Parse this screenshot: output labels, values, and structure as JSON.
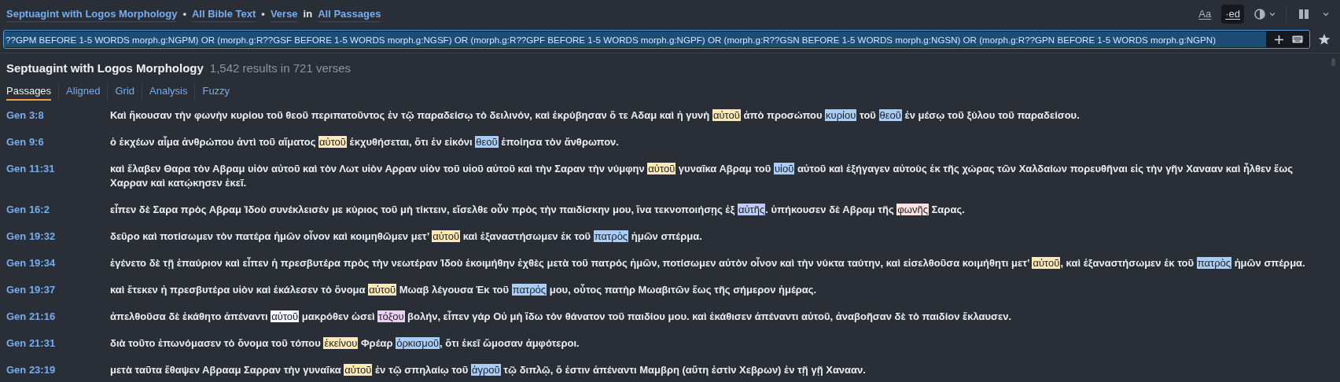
{
  "breadcrumb": [
    {
      "kind": "link",
      "text": "Septuagint with Logos Morphology"
    },
    {
      "kind": "dot",
      "text": "•"
    },
    {
      "kind": "link",
      "text": "All Bible Text"
    },
    {
      "kind": "dot",
      "text": "•"
    },
    {
      "kind": "link",
      "text": "Verse"
    },
    {
      "kind": "plain",
      "text": "in"
    },
    {
      "kind": "link",
      "text": "All Passages"
    }
  ],
  "toolbar": [
    {
      "kind": "text",
      "label": "Aa",
      "selected": false
    },
    {
      "kind": "text",
      "label": "·ed",
      "selected": true
    },
    {
      "kind": "contrast"
    },
    {
      "kind": "columns"
    }
  ],
  "query": {
    "value": "??GPM BEFORE 1-5 WORDS morph.g:NGPM) OR (morph.g:R??GSF BEFORE 1-5 WORDS morph.g:NGSF) OR (morph.g:R??GPF BEFORE 1-5 WORDS morph.g:NGPF) OR (morph.g:R??GSN BEFORE 1-5 WORDS morph.g:NGSN) OR (morph.g:R??GPN BEFORE 1-5 WORDS morph.g:NGPN)"
  },
  "results": {
    "title": "Septuagint with Logos Morphology",
    "summary": "1,542 results in 721 verses"
  },
  "tabs": [
    {
      "label": "Passages",
      "selected": true
    },
    {
      "label": "Aligned",
      "selected": false
    },
    {
      "label": "Grid",
      "selected": false
    },
    {
      "label": "Analysis",
      "selected": false
    },
    {
      "label": "Fuzzy",
      "selected": false
    }
  ],
  "verses": [
    {
      "ref": "Gen 3:8",
      "segments": [
        {
          "text": "Καὶ ἤκουσαν τὴν φωνὴν κυρίου τοῦ θεοῦ περιπατοῦντος ἐν τῷ παραδείσῳ τὸ δειλινόν, καὶ ἐκρύβησαν ὅ τε Αδαμ καὶ ἡ γυνὴ "
        },
        {
          "text": "αὐτοῦ",
          "color": "#fde9b4"
        },
        {
          "text": " ἀπὸ προσώπου "
        },
        {
          "text": "κυρίου",
          "color": "#a9cdf7"
        },
        {
          "text": " τοῦ "
        },
        {
          "text": "θεοῦ",
          "color": "#a9cdf7"
        },
        {
          "text": " ἐν μέσῳ τοῦ ξύλου τοῦ παραδείσου."
        }
      ]
    },
    {
      "ref": "Gen 9:6",
      "segments": [
        {
          "text": "ὁ ἐκχέων αἷμα ἀνθρώπου ἀντὶ τοῦ αἵματος "
        },
        {
          "text": "αὐτοῦ",
          "color": "#fde9b4"
        },
        {
          "text": " ἐκχυθήσεται, ὅτι ἐν εἰκόνι "
        },
        {
          "text": "θεοῦ",
          "color": "#a9cdf7"
        },
        {
          "text": " ἐποίησα τὸν ἄνθρωπον."
        }
      ]
    },
    {
      "ref": "Gen 11:31",
      "segments": [
        {
          "text": "καὶ ἔλαβεν Θαρα τὸν Αβραμ υἱὸν αὐτοῦ καὶ τὸν Λωτ υἱὸν Αρραν υἱὸν τοῦ υἱοῦ αὐτοῦ καὶ τὴν Σαραν τὴν νύμφην "
        },
        {
          "text": "αὐτοῦ",
          "color": "#fde9b4"
        },
        {
          "text": " γυναῖκα Αβραμ τοῦ "
        },
        {
          "text": "υἱοῦ",
          "color": "#a9cdf7"
        },
        {
          "text": " αὐτοῦ καὶ ἐξήγαγεν αὐτοὺς ἐκ τῆς χώρας τῶν Χαλδαίων πορευθῆναι εἰς τὴν γῆν Χανααν καὶ ἦλθεν ἕως Χαρραν καὶ κατῴκησεν ἐκεῖ."
        }
      ]
    },
    {
      "ref": "Gen 16:2",
      "segments": [
        {
          "text": "εἶπεν δὲ Σαρα πρὸς Αβραμ Ἰδοὺ συνέκλεισέν με κύριος τοῦ μὴ τίκτειν, εἴσελθε οὖν πρὸς τὴν παιδίσκην μου, ἵνα τεκνοποιήσῃς ἐξ "
        },
        {
          "text": "αὐτῆς",
          "color": "#bccbf7"
        },
        {
          "text": ". ὑπήκουσεν δὲ Αβραμ τῆς "
        },
        {
          "text": "φωνῆς",
          "color": "#fde2e0"
        },
        {
          "text": " Σαρας."
        }
      ]
    },
    {
      "ref": "Gen 19:32",
      "segments": [
        {
          "text": "δεῦρο καὶ ποτίσωμεν τὸν πατέρα ἡμῶν οἶνον καὶ κοιμηθῶμεν μετ’ "
        },
        {
          "text": "αὐτοῦ",
          "color": "#fde9b4"
        },
        {
          "text": " καὶ ἐξαναστήσωμεν ἐκ τοῦ "
        },
        {
          "text": "πατρὸς",
          "color": "#a9cdf7"
        },
        {
          "text": " ἡμῶν σπέρμα."
        }
      ]
    },
    {
      "ref": "Gen 19:34",
      "segments": [
        {
          "text": "ἐγένετο δὲ τῇ ἐπαύριον καὶ εἶπεν ἡ πρεσβυτέρα πρὸς τὴν νεωτέραν Ἰδοὺ ἐκοιμήθην ἐχθὲς μετὰ τοῦ πατρός ἡμῶν, ποτίσωμεν αὐτὸν οἶνον καὶ τὴν νύκτα ταύτην, καὶ εἰσελθοῦσα κοιμήθητι μετ’ "
        },
        {
          "text": "αὐτοῦ",
          "color": "#fde9b4"
        },
        {
          "text": ", καὶ ἐξαναστήσωμεν ἐκ τοῦ "
        },
        {
          "text": "πατρὸς",
          "color": "#a9cdf7"
        },
        {
          "text": " ἡμῶν σπέρμα."
        }
      ]
    },
    {
      "ref": "Gen 19:37",
      "segments": [
        {
          "text": "καὶ ἔτεκεν ἡ πρεσβυτέρα υἱὸν καὶ ἐκάλεσεν τὸ ὄνομα "
        },
        {
          "text": "αὐτοῦ",
          "color": "#fde9b4"
        },
        {
          "text": " Μωαβ λέγουσα Ἐκ τοῦ "
        },
        {
          "text": "πατρός",
          "color": "#a9cdf7"
        },
        {
          "text": " μου, οὗτος πατὴρ Μωαβιτῶν ἕως τῆς σήμερον ἡμέρας."
        }
      ]
    },
    {
      "ref": "Gen 21:16",
      "segments": [
        {
          "text": "ἀπελθοῦσα δὲ ἐκάθητο ἀπέναντι "
        },
        {
          "text": "αὐτοῦ",
          "color": "#f4f6fb"
        },
        {
          "text": " μακρόθεν ὡσεὶ "
        },
        {
          "text": "τόξου",
          "color": "#e9d0f1"
        },
        {
          "text": " βολήν, εἶπεν γάρ Οὐ μὴ ἴδω τὸν θάνατον τοῦ παιδίου μου. καὶ ἐκάθισεν ἀπέναντι αὐτοῦ, ἀναβοῆσαν δὲ τὸ παιδίον ἔκλαυσεν."
        }
      ]
    },
    {
      "ref": "Gen 21:31",
      "segments": [
        {
          "text": "διὰ τοῦτο ἐπωνόμασεν τὸ ὄνομα τοῦ τόπου "
        },
        {
          "text": "ἐκείνου",
          "color": "#fde9b4"
        },
        {
          "text": " Φρέαρ "
        },
        {
          "text": "ὁρκισμοῦ",
          "color": "#a9cdf7"
        },
        {
          "text": ", ὅτι ἐκεῖ ὤμοσαν ἀμφότεροι."
        }
      ]
    },
    {
      "ref": "Gen 23:19",
      "segments": [
        {
          "text": "μετὰ ταῦτα ἔθαψεν Αβρααμ Σαρραν τὴν γυναῖκα "
        },
        {
          "text": "αὐτοῦ",
          "color": "#fde9b4"
        },
        {
          "text": " ἐν τῷ σπηλαίῳ τοῦ "
        },
        {
          "text": "ἀγροῦ",
          "color": "#a9cdf7"
        },
        {
          "text": " τῷ διπλῷ, ὅ ἐστιν ἀπέναντι Μαμβρη (αὕτη ἐστὶν Χεβρων) ἐν τῇ γῇ Χανααν."
        }
      ]
    }
  ]
}
